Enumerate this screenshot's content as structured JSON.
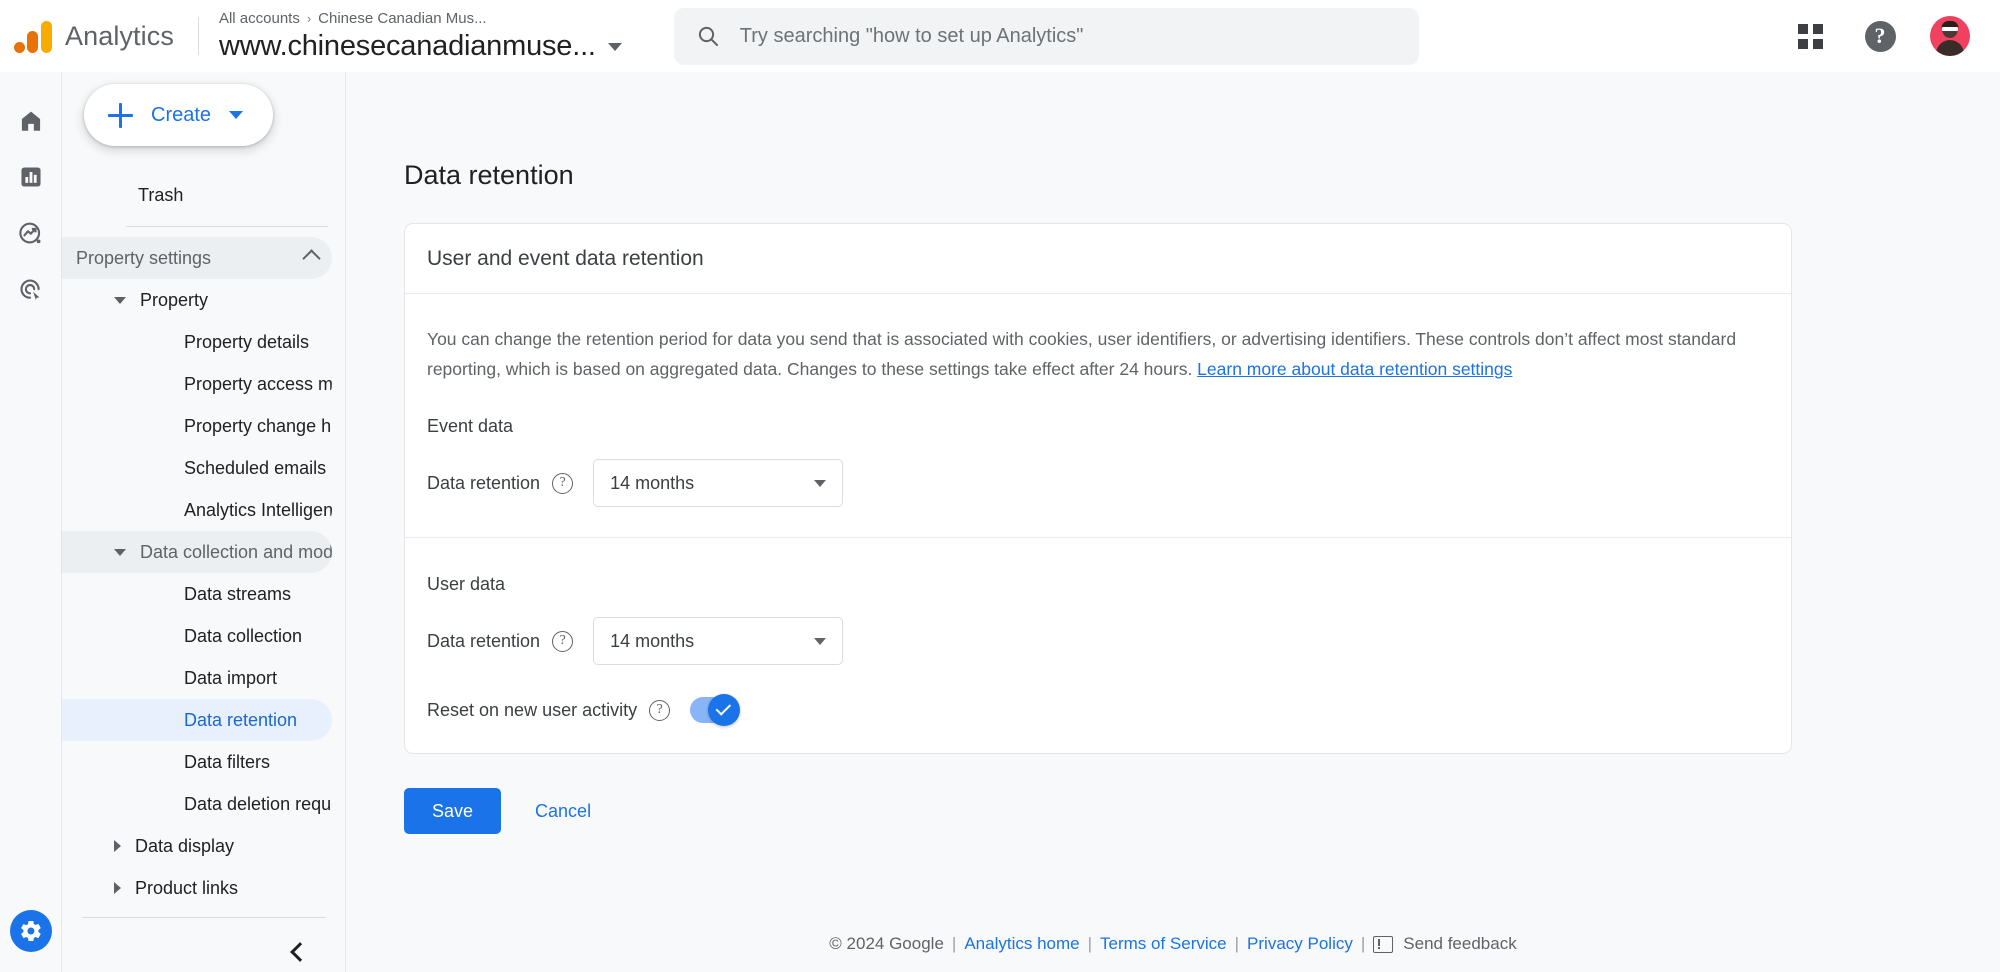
{
  "topbar": {
    "brand": "Analytics",
    "breadcrumb_root": "All accounts",
    "breadcrumb_sep": "›",
    "breadcrumb_account": "Chinese Canadian Mus...",
    "property_name": "www.chinesecanadianmuse...",
    "search_placeholder": "Try searching \"how to set up Analytics\"",
    "search_value": "",
    "apps_icon": "apps-grid-icon",
    "help_icon": "help-question-icon",
    "help_glyph": "?",
    "avatar_icon": "user-avatar"
  },
  "rail": {
    "items": [
      {
        "name": "home",
        "icon": "home-icon"
      },
      {
        "name": "reports",
        "icon": "bar-chart-icon"
      },
      {
        "name": "explore",
        "icon": "explore-trending-icon"
      },
      {
        "name": "advertising",
        "icon": "advertising-target-icon"
      }
    ],
    "admin": {
      "name": "admin",
      "icon": "gear-icon"
    }
  },
  "sidebar": {
    "create_label": "Create",
    "create_icon": "plus-icon",
    "create_caret_icon": "caret-down-icon",
    "collapse_icon": "chevron-left-icon",
    "items": [
      {
        "label": "Trash",
        "level": "lvl-1"
      },
      {
        "label": "Property settings",
        "level": "lvl-top",
        "state": "shade",
        "trailing": "chevron-up-icon"
      },
      {
        "label": "Property",
        "level": "group",
        "marker": "caret-down"
      },
      {
        "label": "Property details",
        "level": "lvl-2"
      },
      {
        "label": "Property access managem...",
        "level": "lvl-2"
      },
      {
        "label": "Property change history",
        "level": "lvl-2"
      },
      {
        "label": "Scheduled emails",
        "level": "lvl-2"
      },
      {
        "label": "Analytics Intelligence sear...",
        "level": "lvl-2"
      },
      {
        "label": "Data collection and modifica...",
        "level": "group",
        "state": "shade",
        "marker": "caret-down"
      },
      {
        "label": "Data streams",
        "level": "lvl-2"
      },
      {
        "label": "Data collection",
        "level": "lvl-2"
      },
      {
        "label": "Data import",
        "level": "lvl-2"
      },
      {
        "label": "Data retention",
        "level": "lvl-2",
        "state": "sel"
      },
      {
        "label": "Data filters",
        "level": "lvl-2"
      },
      {
        "label": "Data deletion requests",
        "level": "lvl-2"
      },
      {
        "label": "Data display",
        "level": "group",
        "marker": "caret-right"
      },
      {
        "label": "Product links",
        "level": "group",
        "marker": "caret-right"
      }
    ]
  },
  "main": {
    "page_title": "Data retention",
    "card_title": "User and event data retention",
    "description_part1": "You can change the retention period for data you send that is associated with cookies, user identifiers, or advertising identifiers. These controls don’t affect most standard reporting, which is based on aggregated data. Changes to these settings take effect after 24 hours. ",
    "description_link": "Learn more about data retention settings",
    "event_section": {
      "heading": "Event data",
      "retention_label": "Data retention",
      "help_icon": "help-question-icon",
      "retention_value": "14 months",
      "caret_icon": "caret-down-icon"
    },
    "user_section": {
      "heading": "User data",
      "retention_label": "Data retention",
      "help_icon": "help-question-icon",
      "retention_value": "14 months",
      "caret_icon": "caret-down-icon",
      "reset_label": "Reset on new user activity",
      "reset_help_icon": "help-question-icon",
      "reset_enabled": "on"
    },
    "save_label": "Save",
    "cancel_label": "Cancel"
  },
  "footer": {
    "copyright": "© 2024 Google",
    "pipe": "|",
    "analytics_home": "Analytics home",
    "terms": "Terms of Service",
    "privacy": "Privacy Policy",
    "feedback": "Send feedback",
    "feedback_icon": "feedback-icon"
  },
  "colors": {
    "accent_blue": "#1a73e8",
    "logo_orange": "#E8710A",
    "logo_yellow": "#F9AB00",
    "avatar_pink": "#f0425e",
    "selected_bg": "#e8f0fe"
  }
}
